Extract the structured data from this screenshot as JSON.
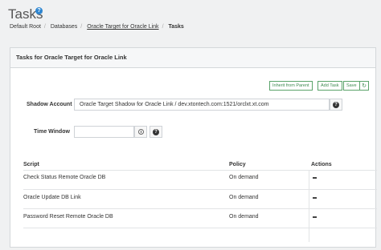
{
  "page": {
    "title": "Tasks"
  },
  "breadcrumb": [
    "Default Root",
    "Databases",
    "Oracle Target for Oracle Link",
    "Tasks"
  ],
  "panel": {
    "heading": "Tasks for Oracle Target for Oracle Link"
  },
  "toolbar": {
    "inherit": "Inherit from Parent",
    "add": "Add Task",
    "save": "Save"
  },
  "form": {
    "shadow_label": "Shadow Account",
    "shadow_value": "Oracle Target Shadow for Oracle Link / dev.xtontech.com:1521/orclxt.xt.com",
    "window_label": "Time Window",
    "window_value": ""
  },
  "table": {
    "headers": [
      "Script",
      "Policy",
      "Actions"
    ],
    "rows": [
      {
        "script": "Check Status Remote Oracle DB",
        "policy": "On demand"
      },
      {
        "script": "Oracle Update DB Link",
        "policy": "On demand"
      },
      {
        "script": "Password Reset Remote Oracle DB",
        "policy": "On demand"
      }
    ]
  },
  "icons": [
    "help-icon",
    "clock-icon",
    "refresh-icon",
    "menu-icon"
  ],
  "colors": {
    "accent": "#2e86d1",
    "button_green": "#3c8a4f"
  }
}
